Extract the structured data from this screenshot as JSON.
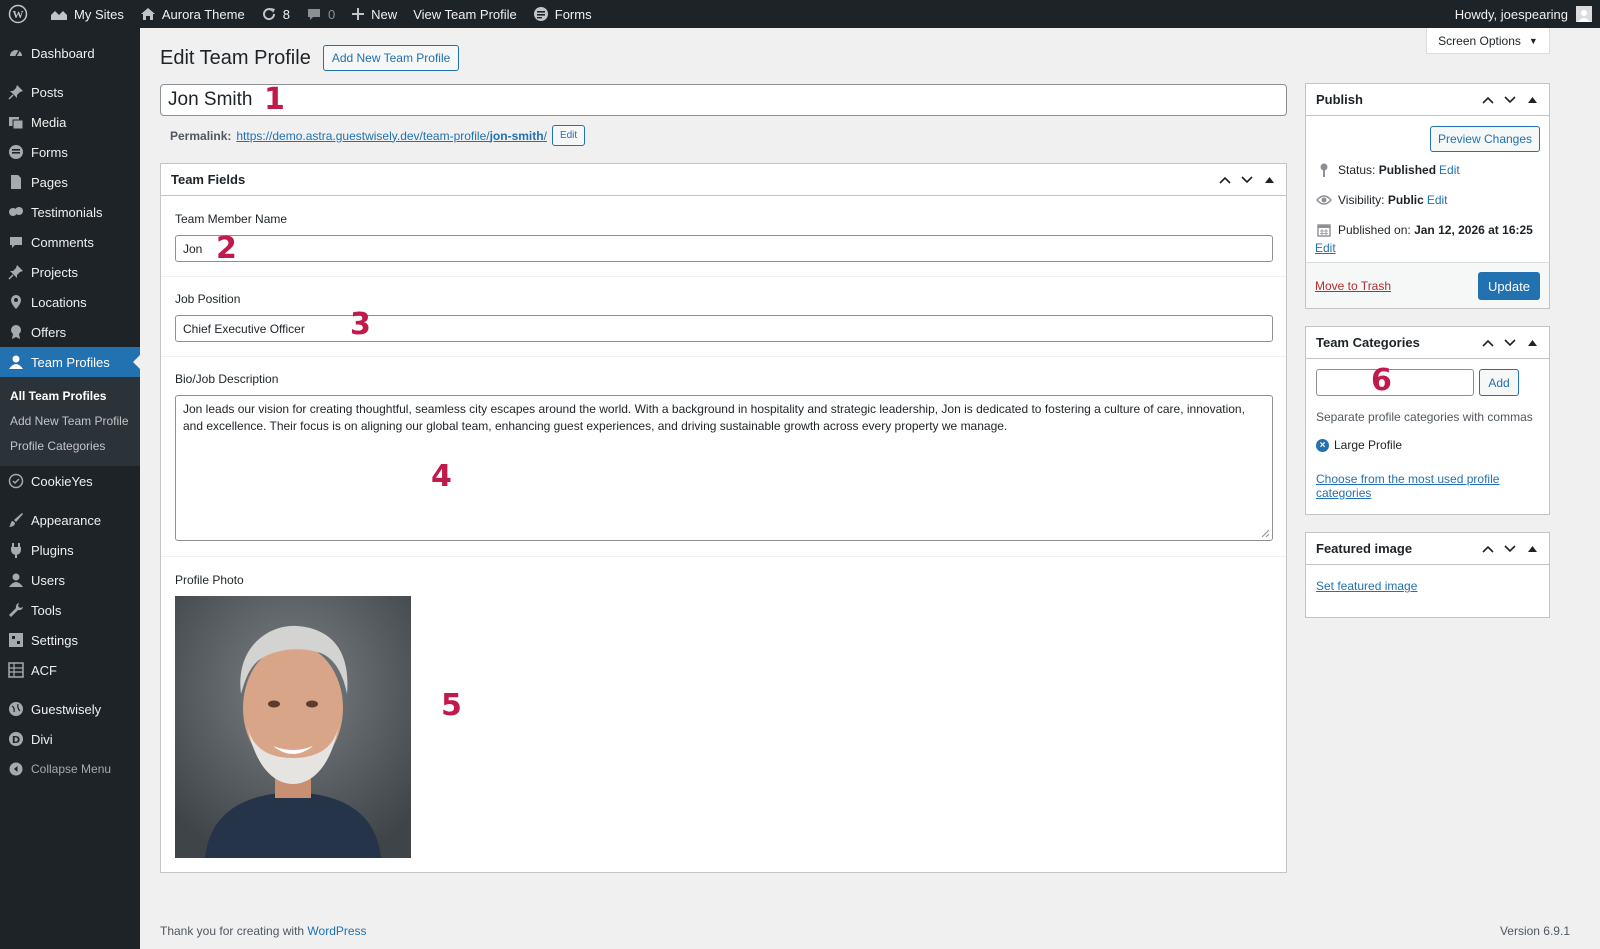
{
  "adminbar": {
    "my_sites": "My Sites",
    "site_name": "Aurora Theme",
    "updates_count": "8",
    "comments_count": "0",
    "new_label": "New",
    "view_label": "View Team Profile",
    "forms_label": "Forms",
    "howdy": "Howdy, joespearing"
  },
  "sidebar": {
    "items": [
      {
        "label": "Dashboard",
        "icon": "dashboard-icon"
      },
      {
        "label": "Posts",
        "icon": "pin-icon"
      },
      {
        "label": "Media",
        "icon": "media-icon"
      },
      {
        "label": "Forms",
        "icon": "forms-icon"
      },
      {
        "label": "Pages",
        "icon": "page-icon"
      },
      {
        "label": "Testimonials",
        "icon": "testimonials-icon"
      },
      {
        "label": "Comments",
        "icon": "comment-icon"
      },
      {
        "label": "Projects",
        "icon": "pin-icon"
      },
      {
        "label": "Locations",
        "icon": "location-icon"
      },
      {
        "label": "Offers",
        "icon": "award-icon"
      },
      {
        "label": "Team Profiles",
        "icon": "user-icon"
      },
      {
        "label": "CookieYes",
        "icon": "cookie-icon"
      },
      {
        "label": "Appearance",
        "icon": "brush-icon"
      },
      {
        "label": "Plugins",
        "icon": "plugin-icon"
      },
      {
        "label": "Users",
        "icon": "users-icon"
      },
      {
        "label": "Tools",
        "icon": "wrench-icon"
      },
      {
        "label": "Settings",
        "icon": "settings-icon"
      },
      {
        "label": "ACF",
        "icon": "grid-icon"
      },
      {
        "label": "Guestwisely",
        "icon": "globe-icon"
      },
      {
        "label": "Divi",
        "icon": "divi-icon"
      }
    ],
    "submenu": [
      "All Team Profiles",
      "Add New Team Profile",
      "Profile Categories"
    ],
    "collapse": "Collapse Menu"
  },
  "header": {
    "screen_options": "Screen Options",
    "title": "Edit Team Profile",
    "add_new": "Add New Team Profile"
  },
  "post": {
    "title": "Jon Smith",
    "permalink_label": "Permalink:",
    "permalink_base": "https://demo.astra.guestwisely.dev/team-profile/",
    "permalink_slug": "jon-smith",
    "permalink_end": "/",
    "edit_label": "Edit"
  },
  "team_fields": {
    "heading": "Team Fields",
    "name_label": "Team Member Name",
    "name_value": "Jon",
    "job_label": "Job Position",
    "job_value": "Chief Executive Officer",
    "bio_label": "Bio/Job Description",
    "bio_value": "Jon leads our vision for creating thoughtful, seamless city escapes around the world. With a background in hospitality and strategic leadership, Jon is dedicated to fostering a culture of care, innovation, and excellence. Their focus is on aligning our global team, enhancing guest experiences, and driving sustainable growth across every property we manage.",
    "photo_label": "Profile Photo"
  },
  "annotations": [
    "1",
    "2",
    "3",
    "4",
    "5",
    "6"
  ],
  "publish": {
    "heading": "Publish",
    "preview": "Preview Changes",
    "status_label": "Status:",
    "status_value": "Published",
    "visibility_label": "Visibility:",
    "visibility_value": "Public",
    "published_label": "Published on:",
    "published_value": "Jan 12, 2026 at 16:25",
    "edit": "Edit",
    "trash": "Move to Trash",
    "update": "Update"
  },
  "categories": {
    "heading": "Team Categories",
    "add": "Add",
    "help": "Separate profile categories with commas",
    "tag": "Large Profile",
    "choose": "Choose from the most used profile categories"
  },
  "featured": {
    "heading": "Featured image",
    "set": "Set featured image"
  },
  "footer": {
    "thanks_prefix": "Thank you for creating with",
    "thanks_link": "WordPress",
    "version": "Version 6.9.1"
  }
}
